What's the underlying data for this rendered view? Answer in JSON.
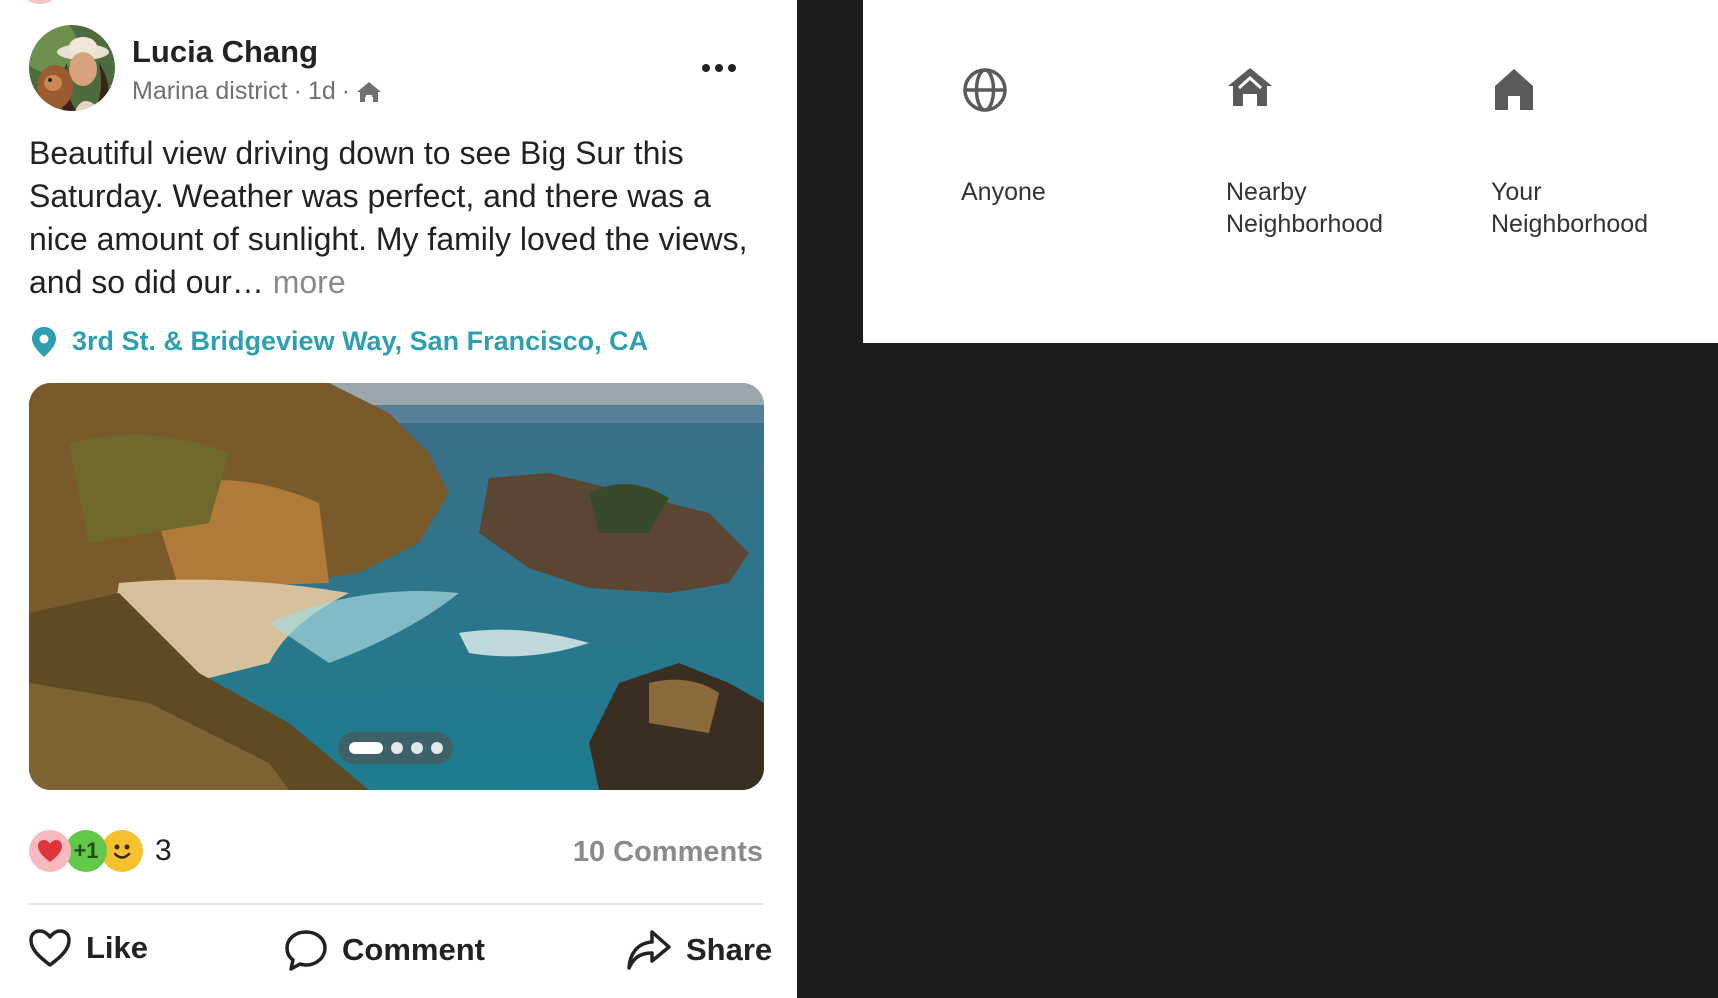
{
  "post": {
    "author": "Lucia Chang",
    "neighborhood": "Marina district",
    "age": "1d",
    "separator": "·",
    "audience_icon": "nearby-neighborhood-icon",
    "body": "Beautiful view driving down to see Big Sur this Saturday. Weather was perfect, and there was a nice amount of sunlight. My family loved the views, and so did our…",
    "more_label": "more",
    "location": "3rd St. & Bridgeview Way, San Francisco, CA",
    "photo": {
      "total_images": 4,
      "current_index": 1
    },
    "reactions": {
      "icons": [
        "heart-reaction-icon",
        "plus-one-reaction-icon",
        "smile-reaction-icon"
      ],
      "plus_one_glyph": "+1",
      "count": "3"
    },
    "comments_label": "10 Comments",
    "actions": {
      "like": "Like",
      "comment": "Comment",
      "share": "Share"
    }
  },
  "audience_panel": {
    "options": [
      {
        "label": "Anyone",
        "icon": "globe-icon"
      },
      {
        "label": "Nearby\nNeighborhood",
        "icon": "nearby-neighborhood-icon"
      },
      {
        "label": "Your\nNeighborhood",
        "icon": "home-icon"
      }
    ]
  },
  "colors": {
    "accent": "#2e9eb1",
    "background_dark": "#1c1c1c",
    "text_primary": "#222222",
    "text_secondary": "#707070",
    "icon_gray": "#5a5a5a"
  }
}
